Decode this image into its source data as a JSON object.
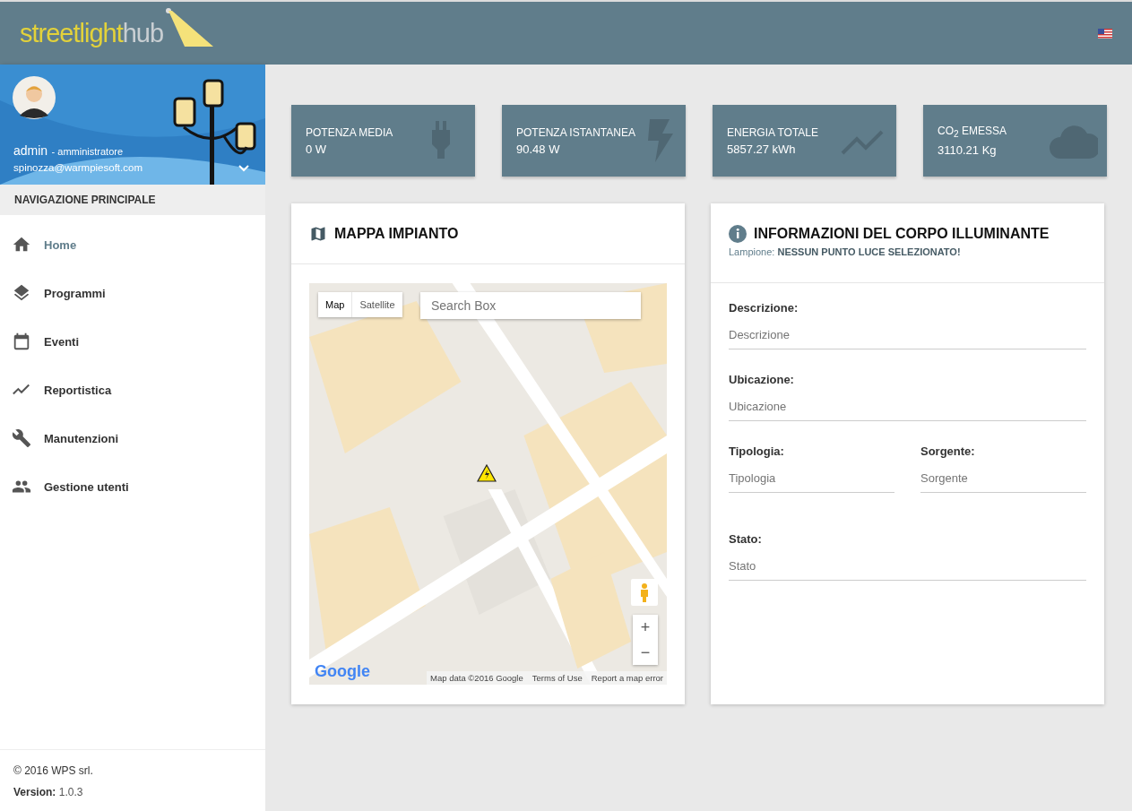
{
  "header": {
    "logo_left": "streetlight",
    "logo_right": "hub"
  },
  "profile": {
    "name": "admin",
    "role": "- amministratore",
    "email": "spinozza@warmpiesoft.com"
  },
  "sidebar": {
    "heading": "NAVIGAZIONE PRINCIPALE",
    "items": [
      {
        "label": "Home",
        "selected": true
      },
      {
        "label": "Programmi",
        "selected": false
      },
      {
        "label": "Eventi",
        "selected": false
      },
      {
        "label": "Reportistica",
        "selected": false
      },
      {
        "label": "Manutenzioni",
        "selected": false
      },
      {
        "label": "Gestione utenti",
        "selected": false
      }
    ],
    "footer": {
      "copyright": "© 2016 WPS srl.",
      "version_label": "Version:",
      "version": "1.0.3"
    }
  },
  "stats": [
    {
      "title": "POTENZA MEDIA",
      "value": "0 W"
    },
    {
      "title": "POTENZA ISTANTANEA",
      "value": "90.48 W"
    },
    {
      "title": "ENERGIA TOTALE",
      "value": "5857.27 kWh"
    },
    {
      "title": "CO$_{2}$ EMESSA",
      "value": "3110.21 Kg"
    }
  ],
  "map_panel": {
    "title": "MAPPA IMPIANTO",
    "map_types": [
      {
        "label": "Map",
        "selected": true
      },
      {
        "label": "Satellite",
        "selected": false
      }
    ],
    "search": {
      "placeholder": "Search Box"
    },
    "zoom_in": "+",
    "zoom_out": "−",
    "logo": "Google",
    "attribution": [
      "Map data ©2016 Google",
      "Terms of Use",
      "Report a map error"
    ]
  },
  "info_panel": {
    "title": "INFORMAZIONI DEL CORPO ILLUMINANTE",
    "subtitle_label": "Lampione:",
    "subtitle_value": "NESSUN PUNTO LUCE SELEZIONATO!",
    "fields": [
      {
        "label": "Descrizione:",
        "placeholder": "Descrizione"
      },
      {
        "label": "Ubicazione:",
        "placeholder": "Ubicazione"
      },
      {
        "label": "Tipologia:",
        "placeholder": "Tipologia"
      },
      {
        "label": "Sorgente:",
        "placeholder": "Sorgente"
      },
      {
        "label": "Stato:",
        "placeholder": "Stato"
      }
    ]
  }
}
